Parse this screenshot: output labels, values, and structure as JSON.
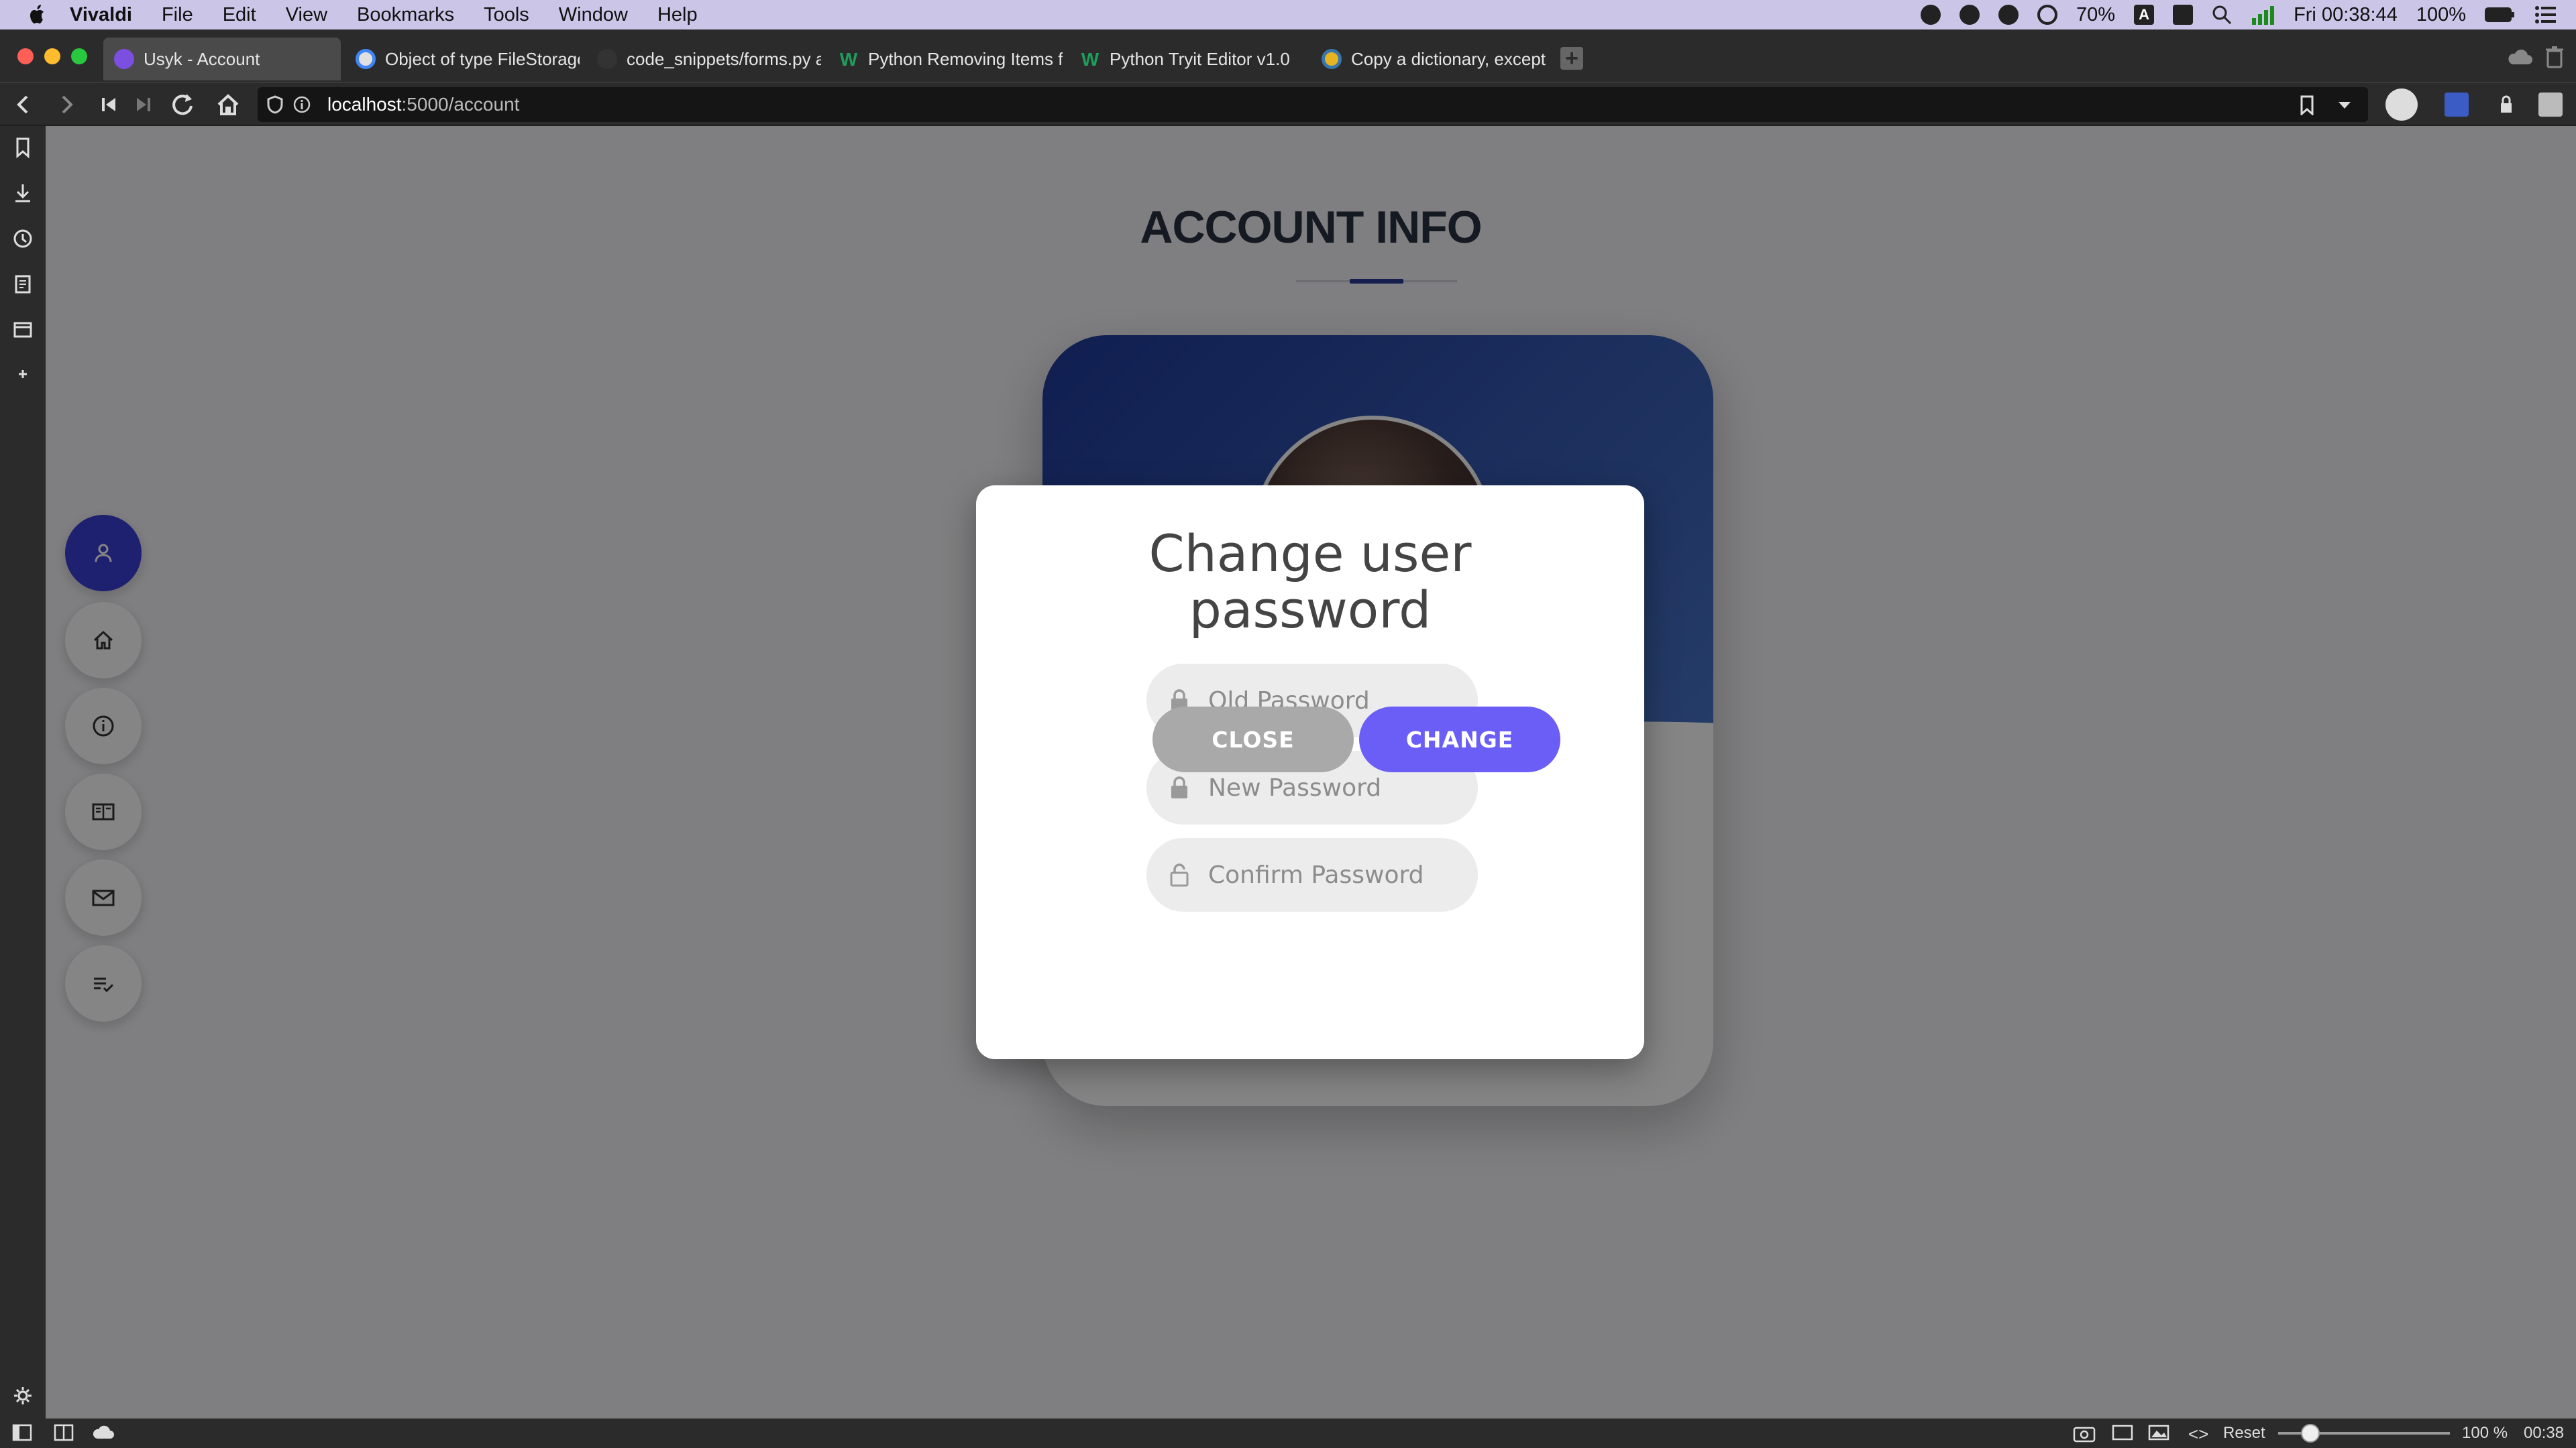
{
  "menubar": {
    "app_name": "Vivaldi",
    "items": [
      "File",
      "Edit",
      "View",
      "Bookmarks",
      "Tools",
      "Window",
      "Help"
    ],
    "battery_small": "70%",
    "keyboard_indicator": "A",
    "datetime": "Fri 00:38:44",
    "battery": "100%"
  },
  "tabs": [
    {
      "label": "Usyk - Account",
      "active": true,
      "favicon_color": "#7b4fe0"
    },
    {
      "label": "Object of type FileStorage",
      "active": false,
      "favicon_color": "#e0e0e0"
    },
    {
      "label": "code_snippets/forms.py a",
      "active": false,
      "favicon_color": "#333333"
    },
    {
      "label": "Python Removing Items fr",
      "active": false,
      "favicon_color": "#1e9e5b"
    },
    {
      "label": "Python Tryit Editor v1.0",
      "active": false,
      "favicon_color": "#1e9e5b"
    },
    {
      "label": "Copy a dictionary, except",
      "active": false,
      "favicon_color": "#e6b422"
    }
  ],
  "address": {
    "host": "localhost",
    "path": ":5000/account"
  },
  "statusbar": {
    "reset_label": "Reset",
    "zoom": "100 %",
    "time": "00:38"
  },
  "page": {
    "title": "ACCOUNT INFO"
  },
  "side_nav": [
    "user-icon",
    "home-icon",
    "info-icon",
    "book-icon",
    "mail-icon",
    "list-check-icon"
  ],
  "modal": {
    "title_line1": "Change user",
    "title_line2": "password",
    "old_password_placeholder": "Old Password",
    "new_password_placeholder": "New Password",
    "confirm_password_placeholder": "Confirm Password",
    "close_label": "CLOSE",
    "change_label": "CHANGE"
  },
  "colors": {
    "accent": "#6a5ef6",
    "nav_active": "#3b3fd6",
    "close_button": "#a9a9a9"
  }
}
